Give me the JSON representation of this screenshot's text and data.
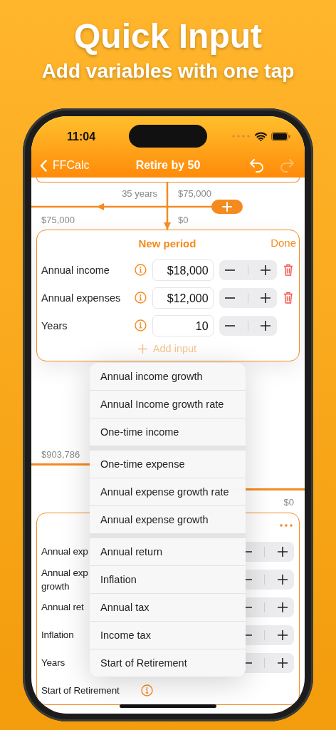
{
  "headline": {
    "title": "Quick Input",
    "subtitle": "Add variables with one tap"
  },
  "status_bar": {
    "time": "11:04"
  },
  "nav_bar": {
    "back": "FFCalc",
    "title": "Retire by 50",
    "redo_disabled": true
  },
  "flow_top": {
    "duration": "35 years",
    "amount_right": "$75,000",
    "amount_left": "$75,000",
    "amount_down": "$0"
  },
  "period_card": {
    "title": "New period",
    "done": "Done",
    "rows": [
      {
        "label": "Annual income",
        "value": "$18,000",
        "deletable": true
      },
      {
        "label": "Annual expenses",
        "value": "$12,000",
        "deletable": true
      },
      {
        "label": "Years",
        "value": "10",
        "deletable": false
      }
    ],
    "add_input": {
      "label": "Add input",
      "disabled": true
    }
  },
  "flow_middle": {
    "balance_left": "$903,786",
    "balance_right": "$0"
  },
  "second_card": {
    "rows": [
      {
        "lines": [
          "Annual exp"
        ],
        "stepper": true,
        "info": false
      },
      {
        "lines": [
          "Annual exp",
          "growth"
        ],
        "stepper": true,
        "info": false
      },
      {
        "lines": [
          "Annual ret"
        ],
        "stepper": true,
        "info": false
      },
      {
        "lines": [
          "Inflation"
        ],
        "stepper": true,
        "info": false
      },
      {
        "lines": [
          "Years"
        ],
        "stepper": true,
        "info": false
      },
      {
        "lines": [
          "Start of Retirement"
        ],
        "stepper": false,
        "info": true
      }
    ]
  },
  "menu": {
    "groups": [
      [
        "Annual income growth",
        "Annual Income growth rate",
        "One-time income"
      ],
      [
        "One-time expense",
        "Annual expense growth rate",
        "Annual expense growth"
      ],
      [
        "Annual return",
        "Inflation",
        "Annual tax",
        "Income tax",
        "Start of Retirement"
      ]
    ]
  }
}
